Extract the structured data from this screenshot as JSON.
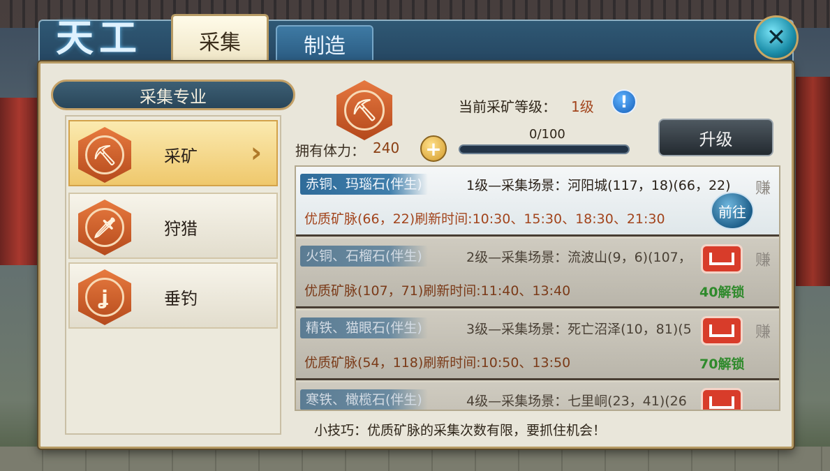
{
  "header": {
    "logo_text": "天工",
    "tabs": [
      {
        "label": "采集",
        "active": true
      },
      {
        "label": "制造",
        "active": false
      }
    ]
  },
  "sidebar": {
    "title": "采集专业",
    "items": [
      {
        "label": "采矿",
        "icon": "pickaxe-icon",
        "active": true
      },
      {
        "label": "狩猎",
        "icon": "knife-icon",
        "active": false
      },
      {
        "label": "垂钓",
        "icon": "fishhook-icon",
        "active": false
      }
    ]
  },
  "info": {
    "level_label": "当前采矿等级：",
    "level_value": "1级",
    "stamina_label": "拥有体力：",
    "stamina_value": "240",
    "progress_text": "0/100",
    "progress_fraction": 0.0,
    "upgrade_label": "升级"
  },
  "list": [
    {
      "ore": "赤铜、玛瑙石(伴生)",
      "scene": "1级—采集场景：河阳城(117，18)(66，22)",
      "vein": "优质矿脉(66，22)刷新时间:10:30、15:30、18:30、21:30",
      "action": "前往",
      "locked": false,
      "seal": "赚"
    },
    {
      "ore": "火铜、石榴石(伴生)",
      "scene": "2级—采集场景：流波山(9，6)(107，",
      "vein": "优质矿脉(107，71)刷新时间:11:40、13:40",
      "unlock": "40解锁",
      "locked": true,
      "seal": "赚"
    },
    {
      "ore": "精铁、猫眼石(伴生)",
      "scene": "3级—采集场景：死亡沼泽(10，81)(5",
      "vein": "优质矿脉(54，118)刷新时间:10:50、13:50",
      "unlock": "70解锁",
      "locked": true,
      "seal": "赚"
    },
    {
      "ore": "寒铁、橄榄石(伴生)",
      "scene": "4级—采集场景：七里峒(23，41)(26",
      "vein": "",
      "unlock": "",
      "locked": true,
      "seal": ""
    }
  ],
  "tip": "小技巧：优质矿脉的采集次数有限，要抓住机会！",
  "colors": {
    "accent_gold": "#b69a64",
    "tab_blue": "#2a5a80",
    "unlock_green": "#2f8a2c",
    "vein_red": "#a2441c"
  }
}
